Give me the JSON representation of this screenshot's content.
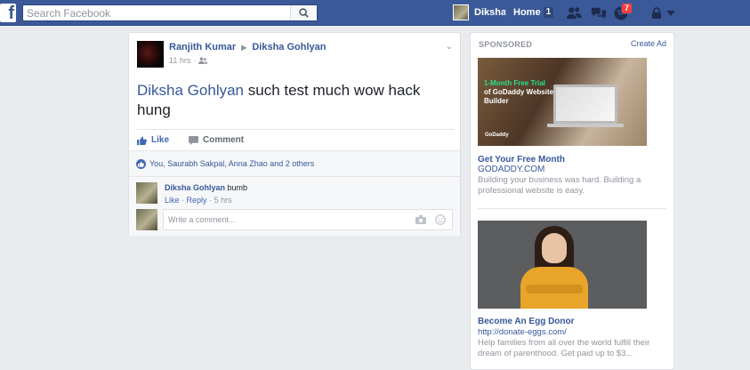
{
  "topbar": {
    "search_placeholder": "Search Facebook",
    "user_name": "Diksha",
    "home_label": "Home",
    "home_count": "1",
    "notification_count": "7",
    "colors": {
      "bar": "#3b5998",
      "badge": "#fa3e3e"
    }
  },
  "post": {
    "author": "Ranjith Kumar",
    "target": "Diksha Gohlyan",
    "time": "11 hrs",
    "mention": "Diksha Gohlyan",
    "message": " such test much wow hack hung",
    "like_label": "Like",
    "comment_label": "Comment",
    "likes_text": "You, Saurabh Sakpal, Anna Zhao and 2 others",
    "comment": {
      "author": "Diksha Gohlyan",
      "text": "bumb",
      "like": "Like",
      "reply": "Reply",
      "time": "5 hrs"
    },
    "comment_placeholder": "Write a comment..."
  },
  "sponsored": {
    "title": "SPONSORED",
    "create_ad": "Create Ad",
    "ads": [
      {
        "image_text_green": "1-Month Free Trial",
        "image_text_white": "of GoDaddy Website Builder",
        "image_logo": "GoDaddy",
        "headline": "Get Your Free Month",
        "domain": "GODADDY.COM",
        "description": "Building your business was hard. Building a professional website is easy."
      },
      {
        "headline": "Become An Egg Donor",
        "domain": "http://donate-eggs.com/",
        "description": "Help families from all over the world fulfill their dream of parenthood. Get paid up to $3..."
      }
    ]
  }
}
